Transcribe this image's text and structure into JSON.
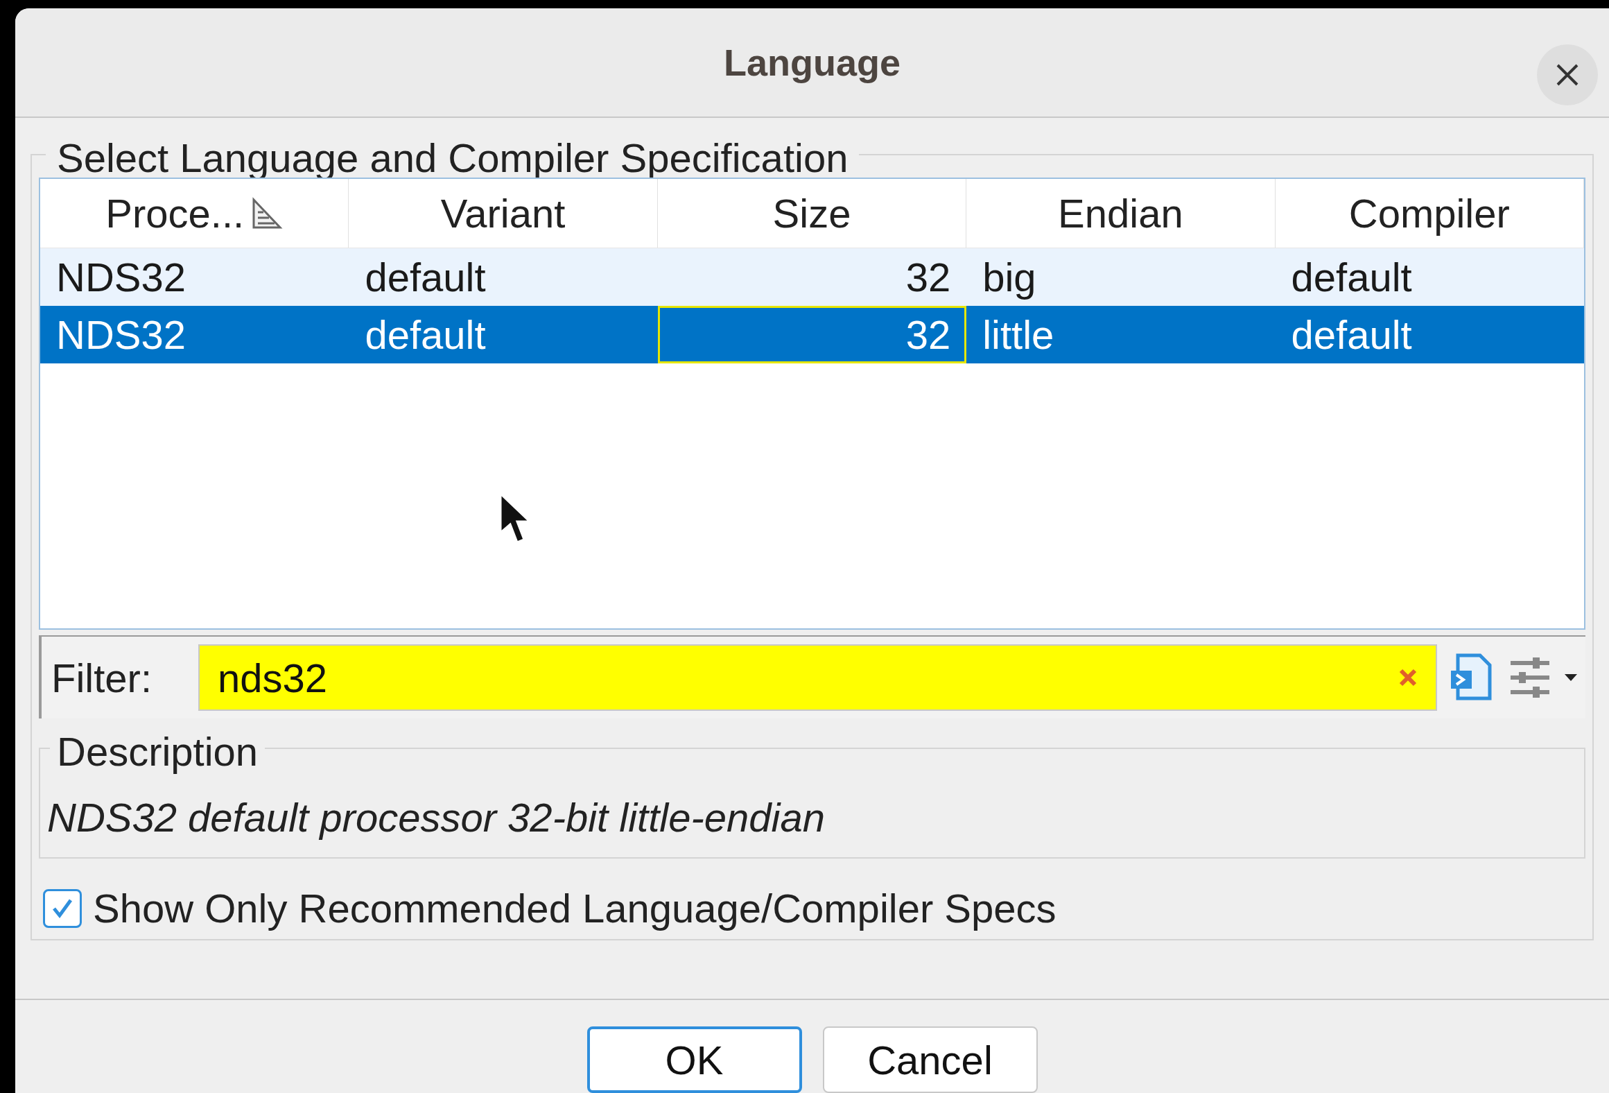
{
  "window": {
    "title": "Language"
  },
  "group": {
    "title": "Select Language and Compiler Specification"
  },
  "table": {
    "columns": [
      {
        "label": "Proce...",
        "sorted": true
      },
      {
        "label": "Variant",
        "sorted": false
      },
      {
        "label": "Size",
        "sorted": false
      },
      {
        "label": "Endian",
        "sorted": false
      },
      {
        "label": "Compiler",
        "sorted": false
      }
    ],
    "rows": [
      {
        "selected": false,
        "cells": [
          {
            "text": "NDS32",
            "focused": false
          },
          {
            "text": "default",
            "focused": false
          },
          {
            "text": "32",
            "focused": false
          },
          {
            "text": "big",
            "focused": false
          },
          {
            "text": "default",
            "focused": false
          }
        ]
      },
      {
        "selected": true,
        "cells": [
          {
            "text": "NDS32",
            "focused": false
          },
          {
            "text": "default",
            "focused": false
          },
          {
            "text": "32",
            "focused": true
          },
          {
            "text": "little",
            "focused": false
          },
          {
            "text": "default",
            "focused": false
          }
        ]
      }
    ]
  },
  "filter": {
    "label": "Filter:",
    "value": "nds32",
    "active": true
  },
  "description": {
    "title": "Description",
    "text": "NDS32 default processor 32-bit little-endian"
  },
  "checkbox": {
    "label": "Show Only Recommended Language/Compiler Specs",
    "checked": true
  },
  "buttons": [
    {
      "label": "OK",
      "default": true
    },
    {
      "label": "Cancel",
      "default": false
    }
  ]
}
